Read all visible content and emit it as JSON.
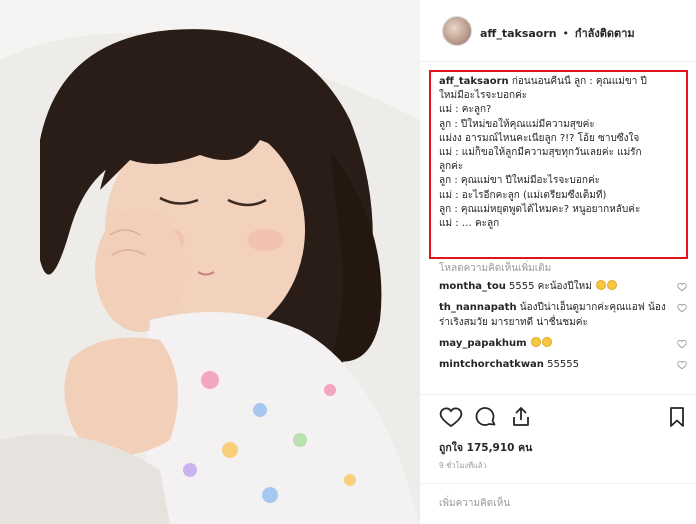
{
  "post": {
    "username": "aff_taksaorn",
    "separator": "•",
    "follow_status": "กำลังติดตาม"
  },
  "caption": {
    "username": "aff_taksaorn",
    "first_line": "ก่อนนอนคืนนี้ ลูก : คุณแม่ขา ปี",
    "lines": [
      "ใหม่มีอะไรจะบอกค่ะ",
      "แม่ : คะลูก?",
      "ลูก : ปีใหม่ขอให้คุณแม่มีความสุขค่ะ",
      "แม่งง อารมณ์ไหนคะเนี่ยลูก ?!? โอ้ย ซาบซึ้งใจ",
      "แม่ : แม่ก็ขอให้ลูกมีความสุขทุกวันเลยค่ะ แม่รัก",
      "ลูกค่ะ",
      "ลูก : คุณแม่ขา ปีใหม่มีอะไรจะบอกค่ะ",
      "แม่ : อะไรอีกคะลูก (แม่เตรียมซึ้งเต็มที่)",
      "ลูก : คุณแม่หยุดพูดได้ไหมคะ? หนูอยากหลับค่ะ",
      "แม่ : … คะลูก"
    ]
  },
  "load_more": "โหลดความคิดเห็นเพิ่มเติม",
  "comments": [
    {
      "user": "montha_tou",
      "text": "5555 คะน้องปีใหม่"
    },
    {
      "user": "th_nannapath",
      "text": "น้องปีน่าเอ็นดูมากค่ะคุณแอฟ น้องร่าเริงสมวัย มารยาทดี น่าชื่นชมค่ะ"
    },
    {
      "user": "may_papakhum",
      "text": ""
    },
    {
      "user": "mintchorchatkwan",
      "text": "55555"
    }
  ],
  "likes": "ถูกใจ 175,910 คน",
  "timestamp": "9 ชั่วโมงที่แล้ว",
  "add_comment_placeholder": "เพิ่มความคิดเห็น",
  "icons": {
    "like": "heart-icon",
    "comment": "comment-icon",
    "share": "share-icon",
    "save": "bookmark-icon"
  },
  "colors": {
    "highlight_border": "#e0141b",
    "muted_text": "#999999"
  }
}
